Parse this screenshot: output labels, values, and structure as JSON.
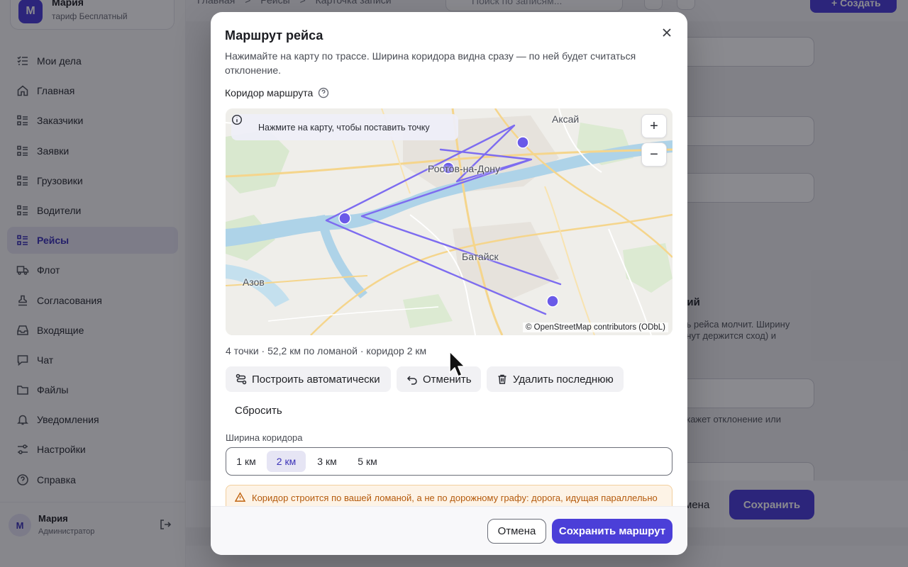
{
  "app": {
    "brand_avatar": "М",
    "brand_name": "Мария",
    "brand_plan": "тариф Бесплатный",
    "breadcrumbs": [
      "Главная",
      ">",
      "Рейсы",
      ">",
      "Карточка записи"
    ],
    "search_placeholder": "Поиск по записям...",
    "create_label": "+ Создать",
    "nav": [
      {
        "label": "Мои дела",
        "icon": "checklist-icon"
      },
      {
        "label": "Главная",
        "icon": "home-icon"
      },
      {
        "label": "Заказчики",
        "icon": "list-icon"
      },
      {
        "label": "Заявки",
        "icon": "list-icon"
      },
      {
        "label": "Грузовики",
        "icon": "list-icon"
      },
      {
        "label": "Водители",
        "icon": "list-icon"
      },
      {
        "label": "Рейсы",
        "icon": "list-icon",
        "active": true
      },
      {
        "label": "Флот",
        "icon": "truck-icon"
      },
      {
        "label": "Согласования",
        "icon": "stamp-icon"
      },
      {
        "label": "Входящие",
        "icon": "inbox-icon"
      },
      {
        "label": "Чат",
        "icon": "chat-icon"
      },
      {
        "label": "Файлы",
        "icon": "folder-icon"
      },
      {
        "label": "Уведомления",
        "icon": "bell-icon"
      },
      {
        "label": "Настройки",
        "icon": "settings-icon"
      },
      {
        "label": "Справка",
        "icon": "help-icon"
      }
    ],
    "user": {
      "avatar": "М",
      "name": "Мария",
      "role": "Администратор"
    },
    "background": {
      "section_title": "сий",
      "text_1": "ль рейса молчит. Ширину",
      "text_2": "инут держится сход) и",
      "text_3": "окажет отклонение или",
      "cancel_label": "мена",
      "save_label": "Сохранить"
    }
  },
  "modal": {
    "title": "Маршрут рейса",
    "description": "Нажимайте на карту по трассе. Ширина коридора видна сразу — по ней будет считаться отклонение.",
    "corridor_label": "Коридор маршрута",
    "map": {
      "hint": "Нажмите на карту, чтобы поставить точку",
      "zoom_in": "+",
      "zoom_out": "−",
      "attribution": "© OpenStreetMap contributors (ODbL)",
      "cities": {
        "aksay": "Аксай",
        "rostov": "Ростов-на-Дону",
        "bataysk": "Батайск",
        "azov": "Азов"
      },
      "route_color": "#7d6cf0",
      "point_color": "#6a5ae8"
    },
    "stats": "4 точки · 52,2 км по ломаной · коридор 2 км",
    "actions": {
      "auto_build": "Построить автоматически",
      "undo": "Отменить",
      "delete_last": "Удалить последнюю",
      "reset": "Сбросить"
    },
    "width_label": "Ширина коридора",
    "width_options": [
      "1 км",
      "2 км",
      "3 км",
      "5 км"
    ],
    "width_selected": "2 км",
    "warning": "Коридор строится по вашей ломаной, а не по дорожному графу: дорога, идущая параллельно",
    "cancel_label": "Отмена",
    "save_label": "Сохранить маршрут"
  }
}
